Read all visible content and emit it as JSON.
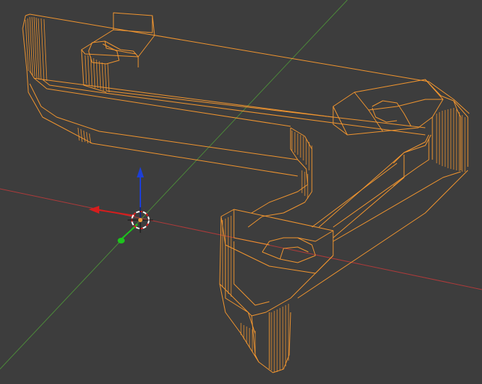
{
  "viewport": {
    "background": "#3d3d3d",
    "wire_color": "#f3962f",
    "axis_x_color": "#b03a3a",
    "axis_y_color": "#4c8a3a",
    "gizmo_up_color": "#1d3fd6",
    "gizmo_left_color": "#d61d1d",
    "gizmo_forward_color": "#1dc41d",
    "icons": {
      "cursor": "3d-cursor-icon",
      "gizmo": "transform-gizmo-icon"
    }
  }
}
